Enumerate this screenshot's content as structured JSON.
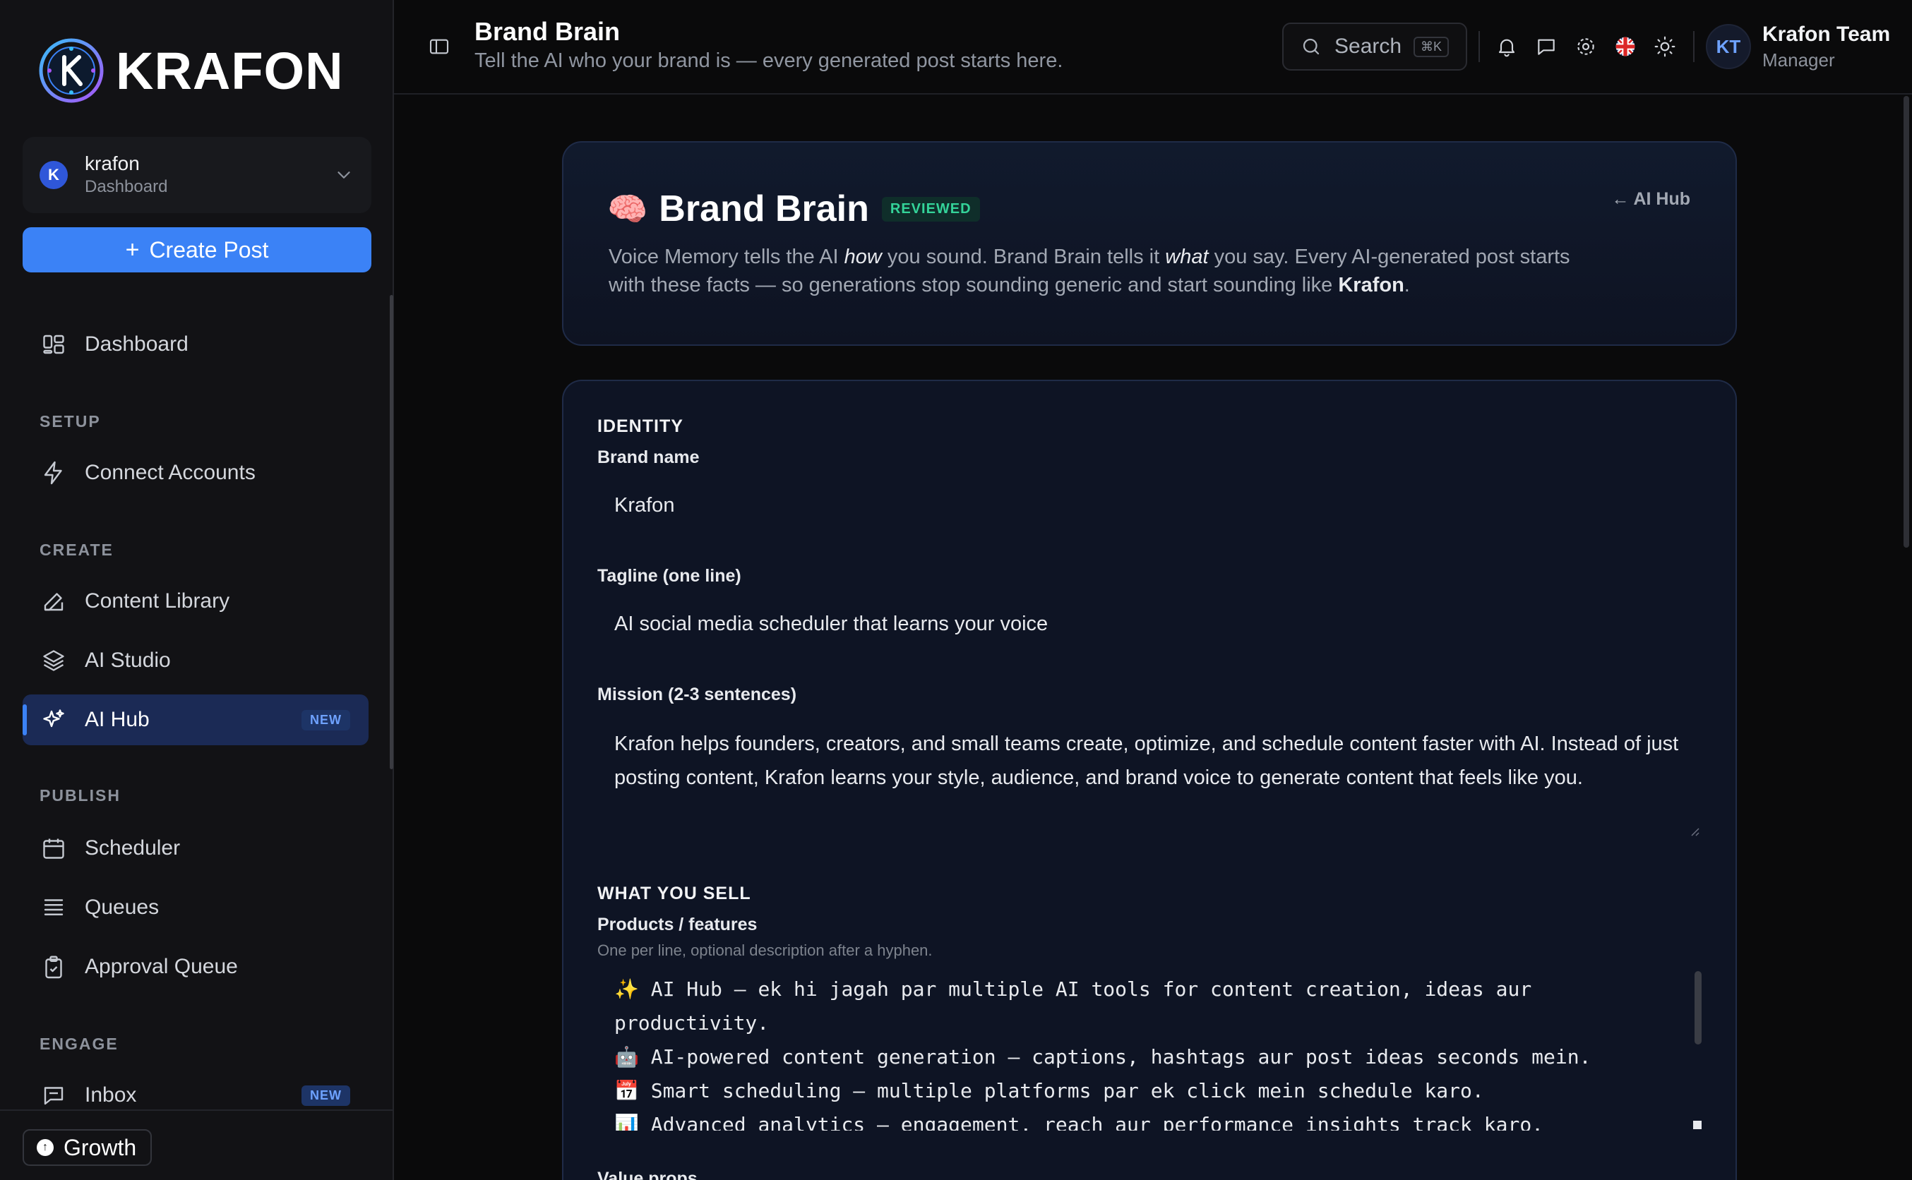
{
  "brand": {
    "logo_text": "KRAFON"
  },
  "workspace": {
    "name": "krafon",
    "subtitle": "Dashboard",
    "avatar_letter": "K"
  },
  "sidebar": {
    "create_label": "Create Post",
    "items": {
      "dashboard": "Dashboard",
      "connect": "Connect Accounts",
      "content": "Content Library",
      "studio": "AI Studio",
      "hub": "AI Hub",
      "scheduler": "Scheduler",
      "queues": "Queues",
      "approval": "Approval Queue",
      "inbox": "Inbox"
    },
    "sections": {
      "setup": "SETUP",
      "create": "CREATE",
      "publish": "PUBLISH",
      "engage": "ENGAGE"
    },
    "badge_new": "NEW",
    "plan": "Growth"
  },
  "topbar": {
    "title": "Brand Brain",
    "subtitle": "Tell the AI who your brand is — every generated post starts here.",
    "search_placeholder": "Search",
    "search_kbd": "⌘K",
    "user_initials": "KT",
    "user_name": "Krafon Team",
    "user_role": "Manager"
  },
  "hero": {
    "emoji": "🧠",
    "title": "Brand Brain",
    "badge": "REVIEWED",
    "back_link": "← AI Hub",
    "desc_1": "Voice Memory tells the AI ",
    "desc_em1": "how",
    "desc_2": " you sound. Brand Brain tells it ",
    "desc_em2": "what",
    "desc_3": " you say. Every AI-generated post starts with these facts — so generations stop sounding generic and start sounding like ",
    "desc_brand": "Krafon",
    "desc_4": "."
  },
  "form": {
    "identity_h": "IDENTITY",
    "brand_name_label": "Brand name",
    "brand_name_value": "Krafon",
    "tagline_label": "Tagline (one line)",
    "tagline_value": "AI social media scheduler that learns your voice",
    "mission_label": "Mission (2-3 sentences)",
    "mission_value": "Krafon helps founders, creators, and small teams create, optimize, and schedule content faster with AI. Instead of just posting content, Krafon learns your style, audience, and brand voice to generate content that feels like you.",
    "sell_h": "WHAT YOU SELL",
    "products_label": "Products / features",
    "products_hint": "One per line, optional description after a hyphen.",
    "products_value": "✨ AI Hub – ek hi jagah par multiple AI tools for content creation, ideas aur productivity.\n🤖 AI-powered content generation – captions, hashtags aur post ideas seconds mein.\n📅 Smart scheduling – multiple platforms par ek click mein schedule karo.\n📊 Advanced analytics – engagement, reach aur performance insights track karo.",
    "value_props_label": "Value props"
  }
}
